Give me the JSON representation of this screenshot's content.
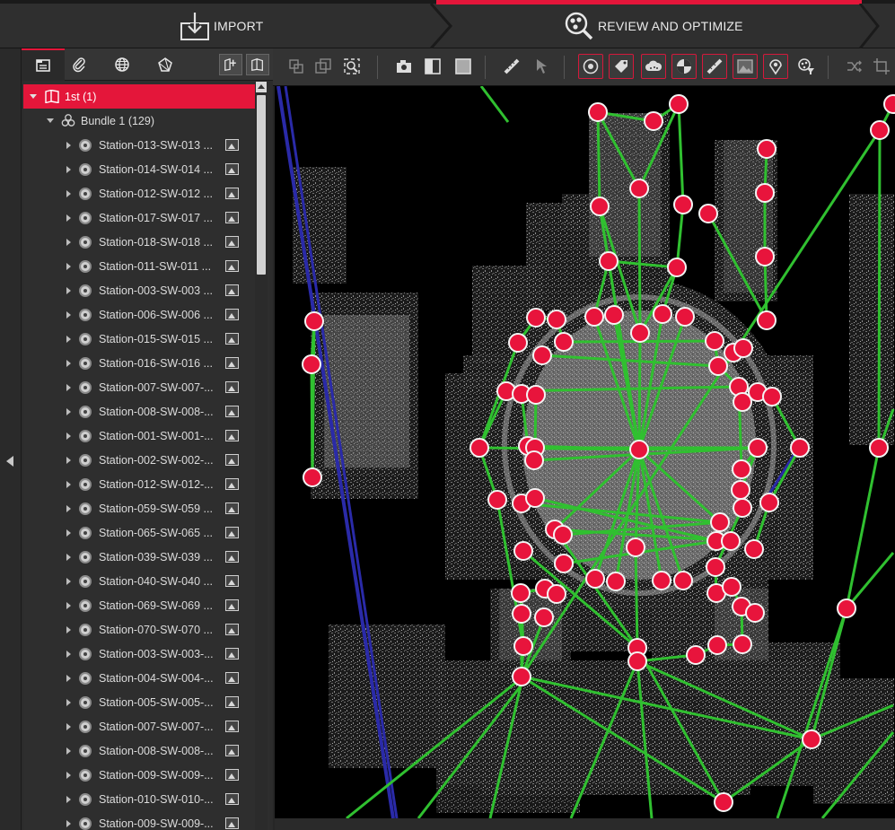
{
  "workflow": {
    "import_label": "IMPORT",
    "review_label": "REVIEW AND OPTIMIZE"
  },
  "colors": {
    "accent": "#e4163a",
    "link": "#2fc02f",
    "scan_path": "#2c2ca8",
    "station": "#e4163a"
  },
  "panel_tabs": [
    "project-tree",
    "attachments",
    "globe",
    "registration"
  ],
  "tree": {
    "project": {
      "label": "1st (1)"
    },
    "bundle": {
      "label": "Bundle 1 (129)"
    },
    "stations": [
      "Station-013-SW-013 ...",
      "Station-014-SW-014 ...",
      "Station-012-SW-012 ...",
      "Station-017-SW-017 ...",
      "Station-018-SW-018 ...",
      "Station-011-SW-011 ...",
      "Station-003-SW-003 ...",
      "Station-006-SW-006 ...",
      "Station-015-SW-015 ...",
      "Station-016-SW-016 ...",
      "Station-007-SW-007-...",
      "Station-008-SW-008-...",
      "Station-001-SW-001-...",
      "Station-002-SW-002-...",
      "Station-012-SW-012-...",
      "Station-059-SW-059 ...",
      "Station-065-SW-065 ...",
      "Station-039-SW-039 ...",
      "Station-040-SW-040 ...",
      "Station-069-SW-069 ...",
      "Station-070-SW-070 ...",
      "Station-003-SW-003-...",
      "Station-004-SW-004-...",
      "Station-005-SW-005-...",
      "Station-007-SW-007-...",
      "Station-008-SW-008-...",
      "Station-009-SW-009-...",
      "Station-010-SW-010-...",
      "Station-009-SW-009-..."
    ]
  },
  "toolbar": [
    "transform-icon",
    "duplicate-icon",
    "zoom-fit-icon",
    "camera-icon",
    "split-view-icon",
    "square-view-icon",
    "measure-icon",
    "pick-icon",
    "station-toggle-icon",
    "tag-icon",
    "cloud-icon",
    "target-icon",
    "link-icon",
    "image-icon",
    "location-icon",
    "filter-icon",
    "shuffle-icon",
    "crop-icon"
  ]
}
